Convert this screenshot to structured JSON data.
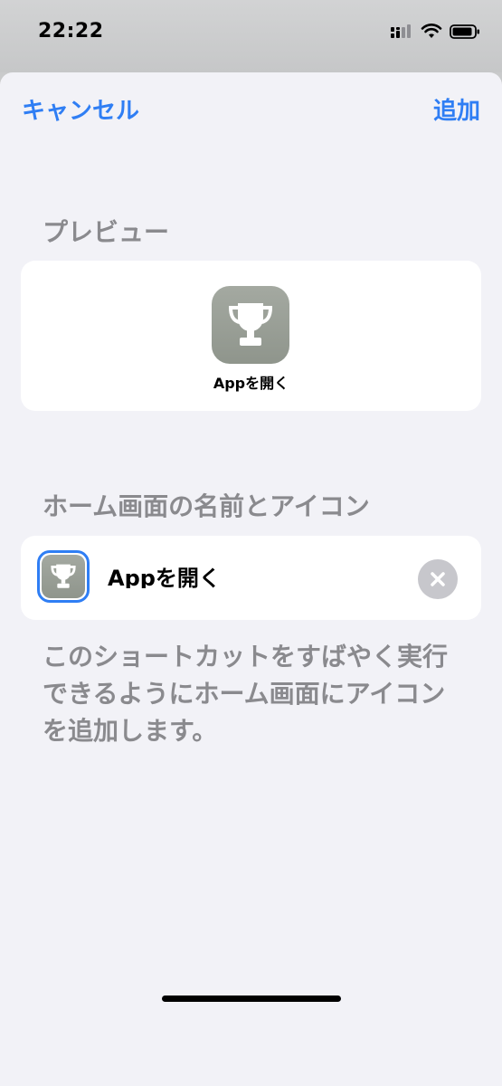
{
  "status_bar": {
    "time": "22:22",
    "icons": [
      "cellular-signal-icon",
      "wifi-icon",
      "battery-icon"
    ]
  },
  "nav": {
    "cancel_label": "キャンセル",
    "add_label": "追加"
  },
  "preview": {
    "header": "プレビュー",
    "app_name": "Appを開く",
    "icon": "trophy-icon"
  },
  "home_screen": {
    "header": "ホーム画面の名前とアイコン",
    "name_value": "Appを開く",
    "icon": "trophy-icon",
    "clear_icon": "clear-icon"
  },
  "footer": {
    "description": "このショートカットをすばやく実行できるようにホーム画面にアイコンを追加します。"
  },
  "colors": {
    "accent": "#2f7ef4",
    "icon_background": "#979c94",
    "sheet_background": "#f2f2f7"
  }
}
